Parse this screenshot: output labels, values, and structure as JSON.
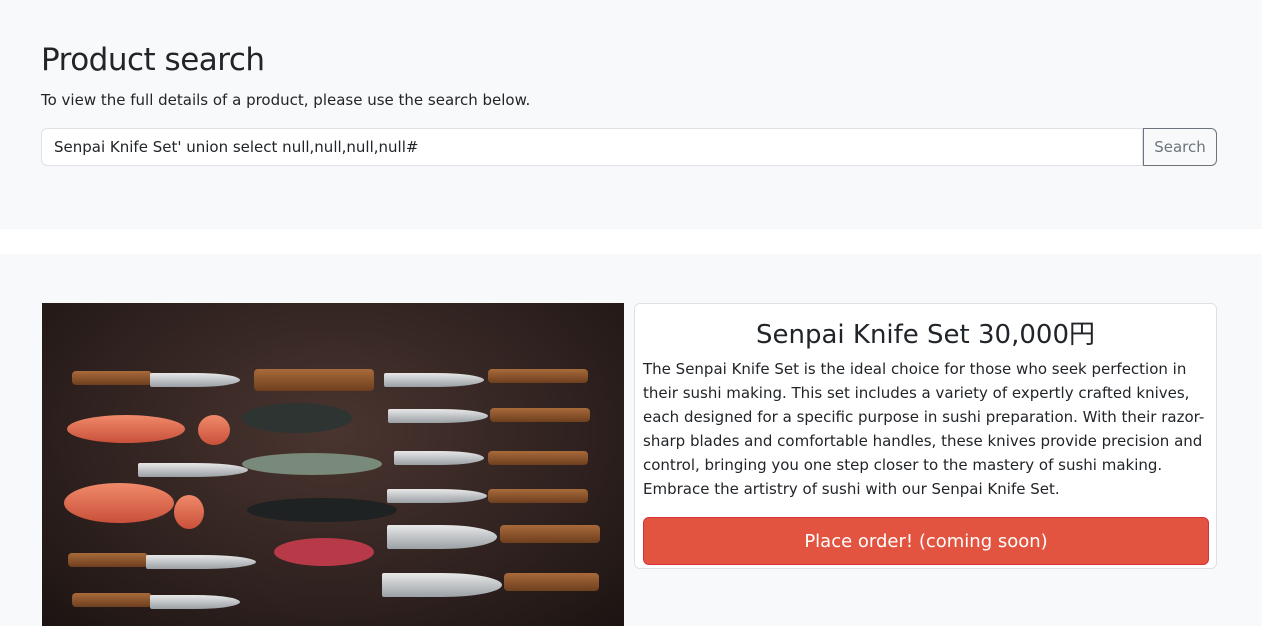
{
  "header": {
    "title": "Product search",
    "subtitle": "To view the full details of a product, please use the search below."
  },
  "search": {
    "value": "Senpai Knife Set' union select null,null,null,null#",
    "button_label": "Search"
  },
  "product": {
    "title": "Senpai Knife Set 30,000円",
    "description": "The Senpai Knife Set is the ideal choice for those who seek perfection in their sushi making. This set includes a variety of expertly crafted knives, each designed for a specific purpose in sushi preparation. With their razor-sharp blades and comfortable handles, these knives provide precision and control, bringing you one step closer to the mastery of sushi making. Embrace the artistry of sushi with our Senpai Knife Set.",
    "order_label": "Place order! (coming soon)"
  },
  "colors": {
    "order_button": "#e35440",
    "section_bg": "#f8f9fa"
  }
}
